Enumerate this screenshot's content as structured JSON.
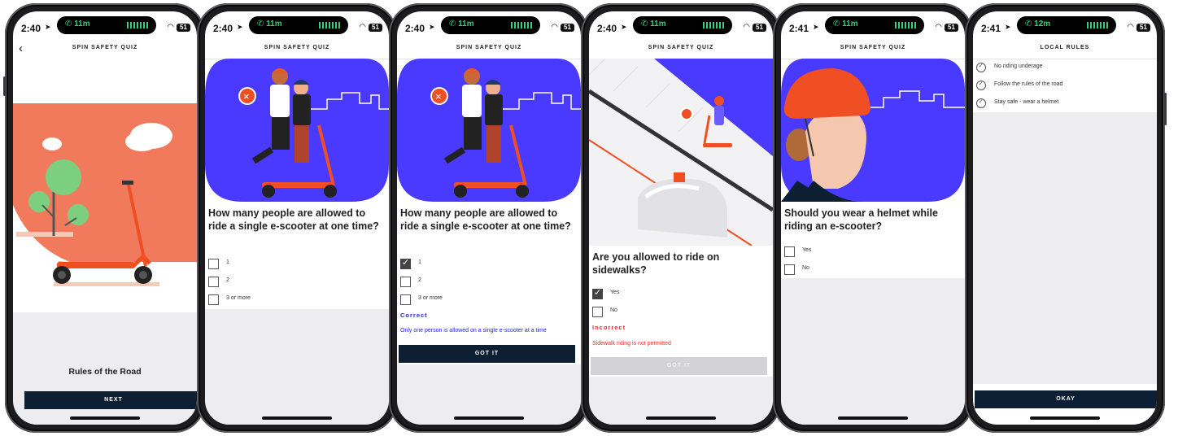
{
  "status": {
    "signal_call_1": "11m",
    "signal_call_2": "12m",
    "battery": "51",
    "times": [
      "2:40",
      "2:40",
      "2:40",
      "2:40",
      "2:41",
      "2:41"
    ]
  },
  "screens": [
    {
      "nav_title": "SPIN SAFETY QUIZ",
      "label": "Rules of the Road",
      "button": "NEXT"
    },
    {
      "nav_title": "SPIN SAFETY QUIZ",
      "question": "How many people are allowed to ride a single e-scooter at one time?",
      "options": [
        "1",
        "2",
        "3 or more"
      ]
    },
    {
      "nav_title": "SPIN SAFETY QUIZ",
      "question": "How many people are allowed to ride a single e-scooter at one time?",
      "options": [
        "1",
        "2",
        "3 or more"
      ],
      "selected": "1",
      "feedback_title": "Correct",
      "feedback_text": "Only one person is allowed on a single e-scooter at a time",
      "button": "GOT IT"
    },
    {
      "nav_title": "SPIN SAFETY QUIZ",
      "question": "Are you allowed to ride on sidewalks?",
      "options": [
        "Yes",
        "No"
      ],
      "selected": "Yes",
      "feedback_title": "Incorrect",
      "feedback_text": "Sidewalk riding is not permitted",
      "button": "GOT IT"
    },
    {
      "nav_title": "SPIN SAFETY QUIZ",
      "question": "Should you wear a helmet while riding an e-scooter?",
      "options": [
        "Yes",
        "No"
      ]
    },
    {
      "nav_title": "LOCAL RULES",
      "rules": [
        "No riding underage",
        "Follow the rules of the road",
        "Stay safe - wear a helmet"
      ],
      "button": "OKAY"
    }
  ],
  "colors": {
    "brand_dark": "#0d1f33",
    "accent_purple": "#4a3aff",
    "spin_orange": "#f04e23",
    "correct_blue": "#1a1aff",
    "incorrect_red": "#e5302a"
  }
}
